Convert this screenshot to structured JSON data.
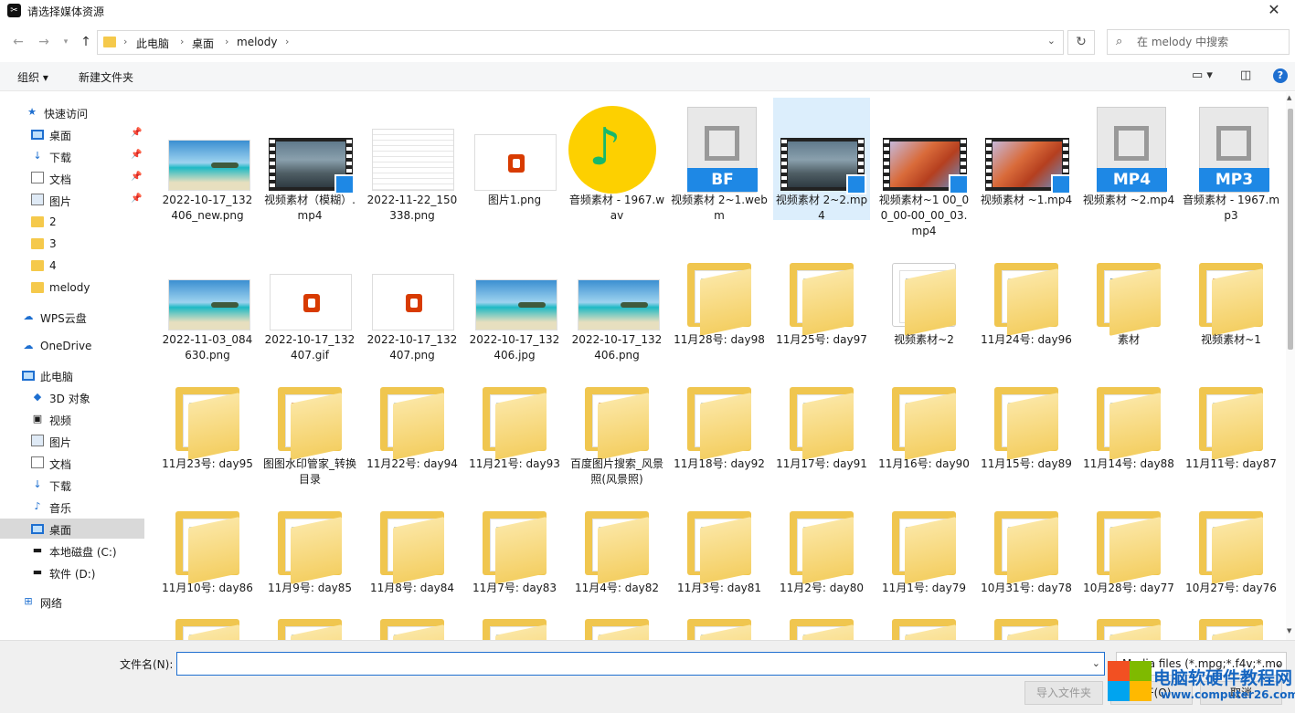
{
  "window": {
    "title": "请选择媒体资源",
    "app_icon": "capcut-icon"
  },
  "nav": {
    "breadcrumbs": [
      "此电脑",
      "桌面",
      "melody"
    ],
    "search_placeholder": "在 melody 中搜索"
  },
  "toolbar": {
    "organize": "组织 ▾",
    "new_folder": "新建文件夹"
  },
  "sidebar": {
    "items": [
      {
        "label": "快速访问",
        "icon": "star-icon",
        "pinned": false
      },
      {
        "label": "桌面",
        "icon": "desktop-icon",
        "pinned": true
      },
      {
        "label": "下载",
        "icon": "download-icon",
        "pinned": true
      },
      {
        "label": "文档",
        "icon": "document-icon",
        "pinned": true
      },
      {
        "label": "图片",
        "icon": "picture-icon",
        "pinned": true
      },
      {
        "label": "2",
        "icon": "folder-icon",
        "pinned": false
      },
      {
        "label": "3",
        "icon": "folder-icon",
        "pinned": false
      },
      {
        "label": "4",
        "icon": "folder-icon",
        "pinned": false
      },
      {
        "label": "melody",
        "icon": "folder-icon",
        "pinned": false
      },
      {
        "label": "WPS云盘",
        "icon": "cloud-icon",
        "pinned": false
      },
      {
        "label": "OneDrive",
        "icon": "onedrive-icon",
        "pinned": false
      },
      {
        "label": "此电脑",
        "icon": "computer-icon",
        "pinned": false
      },
      {
        "label": "3D 对象",
        "icon": "cube-icon",
        "pinned": false
      },
      {
        "label": "视频",
        "icon": "video-icon",
        "pinned": false
      },
      {
        "label": "图片",
        "icon": "picture-icon",
        "pinned": false
      },
      {
        "label": "文档",
        "icon": "document-icon",
        "pinned": false
      },
      {
        "label": "下载",
        "icon": "download-icon",
        "pinned": false
      },
      {
        "label": "音乐",
        "icon": "music-icon",
        "pinned": false
      },
      {
        "label": "桌面",
        "icon": "desktop-icon",
        "pinned": false
      },
      {
        "label": "本地磁盘 (C:)",
        "icon": "drive-icon",
        "pinned": false
      },
      {
        "label": "软件 (D:)",
        "icon": "drive-icon",
        "pinned": false
      },
      {
        "label": "网络",
        "icon": "network-icon",
        "pinned": false
      }
    ],
    "selected_index": 18
  },
  "files": [
    {
      "name": "2022-10-17_132406_new.png",
      "kind": "photo"
    },
    {
      "name": "视频素材（模糊）.mp4",
      "kind": "video"
    },
    {
      "name": "2022-11-22_150338.png",
      "kind": "doc"
    },
    {
      "name": "图片1.png",
      "kind": "office"
    },
    {
      "name": "音频素材 - 1967.wav",
      "kind": "music"
    },
    {
      "name": "视频素材 2~1.webm",
      "kind": "generic",
      "tag": "BF"
    },
    {
      "name": "视频素材 2~2.mp4",
      "kind": "video",
      "selected": true
    },
    {
      "name": "视频素材~1 00_00_00-00_00_03.mp4",
      "kind": "video-leaf"
    },
    {
      "name": "视频素材 ~1.mp4",
      "kind": "video-leaf"
    },
    {
      "name": "视频素材 ~2.mp4",
      "kind": "generic",
      "tag": "MP4"
    },
    {
      "name": "音频素材 - 1967.mp3",
      "kind": "generic",
      "tag": "MP3"
    },
    {
      "name": "2022-11-03_084630.png",
      "kind": "photo"
    },
    {
      "name": "2022-10-17_132407.gif",
      "kind": "office"
    },
    {
      "name": "2022-10-17_132407.png",
      "kind": "office"
    },
    {
      "name": "2022-10-17_132406.jpg",
      "kind": "photo"
    },
    {
      "name": "2022-10-17_132406.png",
      "kind": "photo"
    },
    {
      "name": "11月28号: day98",
      "kind": "folder"
    },
    {
      "name": "11月25号: day97",
      "kind": "folder"
    },
    {
      "name": "视频素材~2",
      "kind": "folder-special"
    },
    {
      "name": "11月24号: day96",
      "kind": "folder"
    },
    {
      "name": "素材",
      "kind": "folder-win"
    },
    {
      "name": "视频素材~1",
      "kind": "folder-photo"
    },
    {
      "name": "11月23号: day95",
      "kind": "folder"
    },
    {
      "name": "图图水印管家_转换目录",
      "kind": "folder-photo"
    },
    {
      "name": "11月22号: day94",
      "kind": "folder"
    },
    {
      "name": "11月21号: day93",
      "kind": "folder"
    },
    {
      "name": "百度图片搜索_风景照(风景照)",
      "kind": "folder-photo"
    },
    {
      "name": "11月18号: day92",
      "kind": "folder"
    },
    {
      "name": "11月17号: day91",
      "kind": "folder"
    },
    {
      "name": "11月16号: day90",
      "kind": "folder"
    },
    {
      "name": "11月15号: day89",
      "kind": "folder"
    },
    {
      "name": "11月14号: day88",
      "kind": "folder"
    },
    {
      "name": "11月11号: day87",
      "kind": "folder"
    },
    {
      "name": "11月10号: day86",
      "kind": "folder"
    },
    {
      "name": "11月9号: day85",
      "kind": "folder"
    },
    {
      "name": "11月8号: day84",
      "kind": "folder"
    },
    {
      "name": "11月7号: day83",
      "kind": "folder"
    },
    {
      "name": "11月4号: day82",
      "kind": "folder"
    },
    {
      "name": "11月3号: day81",
      "kind": "folder"
    },
    {
      "name": "11月2号: day80",
      "kind": "folder"
    },
    {
      "name": "11月1号: day79",
      "kind": "folder"
    },
    {
      "name": "10月31号: day78",
      "kind": "folder"
    },
    {
      "name": "10月28号: day77",
      "kind": "folder"
    },
    {
      "name": "10月27号: day76",
      "kind": "folder"
    }
  ],
  "footer": {
    "filename_label": "文件名(N):",
    "filename_value": "",
    "filter_value": "Media files (*.mpg;*.f4v;*.mo",
    "import_folder": "导入文件夹",
    "open": "打开(O)",
    "cancel": "取消"
  },
  "watermark": {
    "title": "电脑软硬件教程网",
    "url": "www.computer26.com"
  },
  "colors": {
    "accent": "#1e6fd0",
    "folder": "#f0c64f",
    "selection": "#dceefc"
  }
}
